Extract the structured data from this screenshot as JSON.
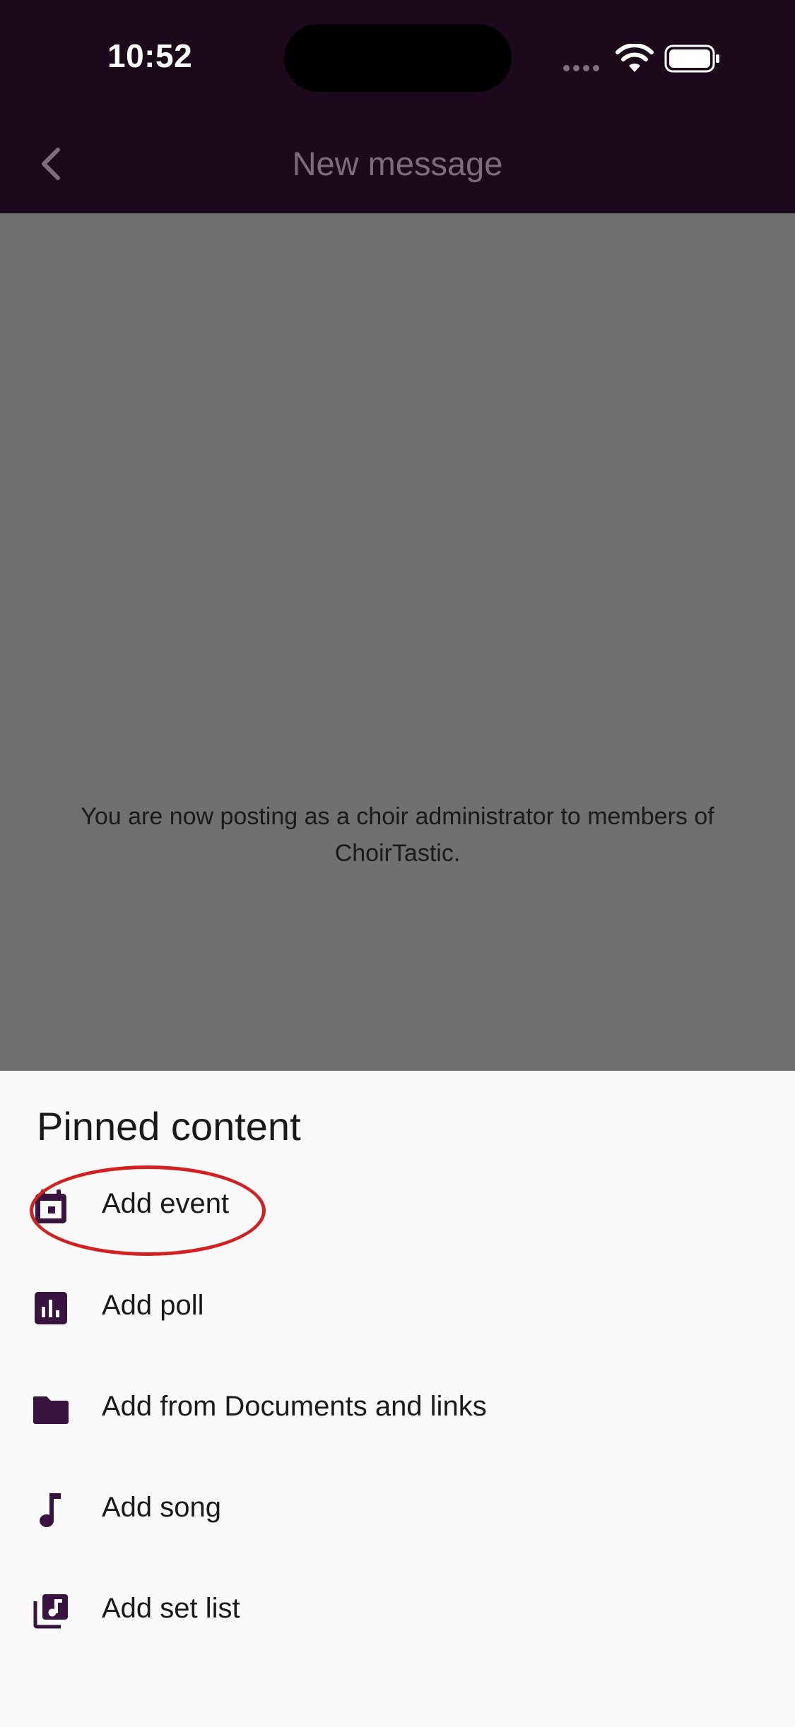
{
  "status_bar": {
    "time": "10:52"
  },
  "app_bar": {
    "title": "New message",
    "back_icon": "chevron-left-icon"
  },
  "notice": "You are now posting as a choir administrator to members of ChoirTastic.",
  "sheet": {
    "title": "Pinned content",
    "items": [
      {
        "label": "Add event",
        "icon": "calendar-icon"
      },
      {
        "label": "Add poll",
        "icon": "poll-chart-icon"
      },
      {
        "label": "Add from Documents and links",
        "icon": "folder-icon"
      },
      {
        "label": "Add song",
        "icon": "music-note-icon"
      },
      {
        "label": "Add set list",
        "icon": "music-library-icon"
      }
    ]
  },
  "colors": {
    "header_bg": "#1c0a1c",
    "accent": "#3a1440",
    "overlay": "#707070",
    "sheet_bg": "#fafafa",
    "annotation": "#d42020"
  }
}
